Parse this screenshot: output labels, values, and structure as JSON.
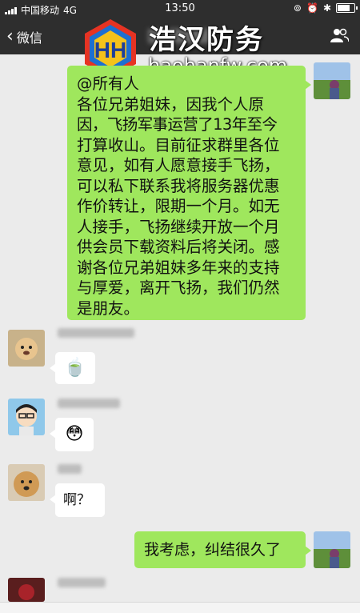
{
  "status_bar": {
    "carrier": "中国移动",
    "network": "4G",
    "time": "13:50"
  },
  "nav": {
    "back_label": "微信"
  },
  "watermark": {
    "title": "浩汉防务",
    "url": "haohanfw.com"
  },
  "messages": [
    {
      "side": "right",
      "lines": [
        "@所有人",
        "各位兄弟姐妹，因我个人原",
        "因，飞扬军事运营了13年至今",
        "打算收山。目前征求群里各位",
        "意见，如有人愿意接手飞扬，",
        "可以私下联系我将服务器优惠",
        "作价转让，限期一个月。如无",
        "人接手，飞扬继续开放一个月",
        "供会员下载资料后将关闭。感",
        "谢各位兄弟姐妹多年来的支持",
        "与厚爱，离开飞扬，我们仍然",
        "是朋友。"
      ]
    },
    {
      "side": "left",
      "type": "emoji",
      "emoji": "🍵"
    },
    {
      "side": "left",
      "type": "emoji",
      "emoji": "😳"
    },
    {
      "side": "left",
      "type": "text",
      "text": "啊？"
    },
    {
      "side": "right",
      "type": "text",
      "text": "我考虑，纠结很久了"
    }
  ]
}
